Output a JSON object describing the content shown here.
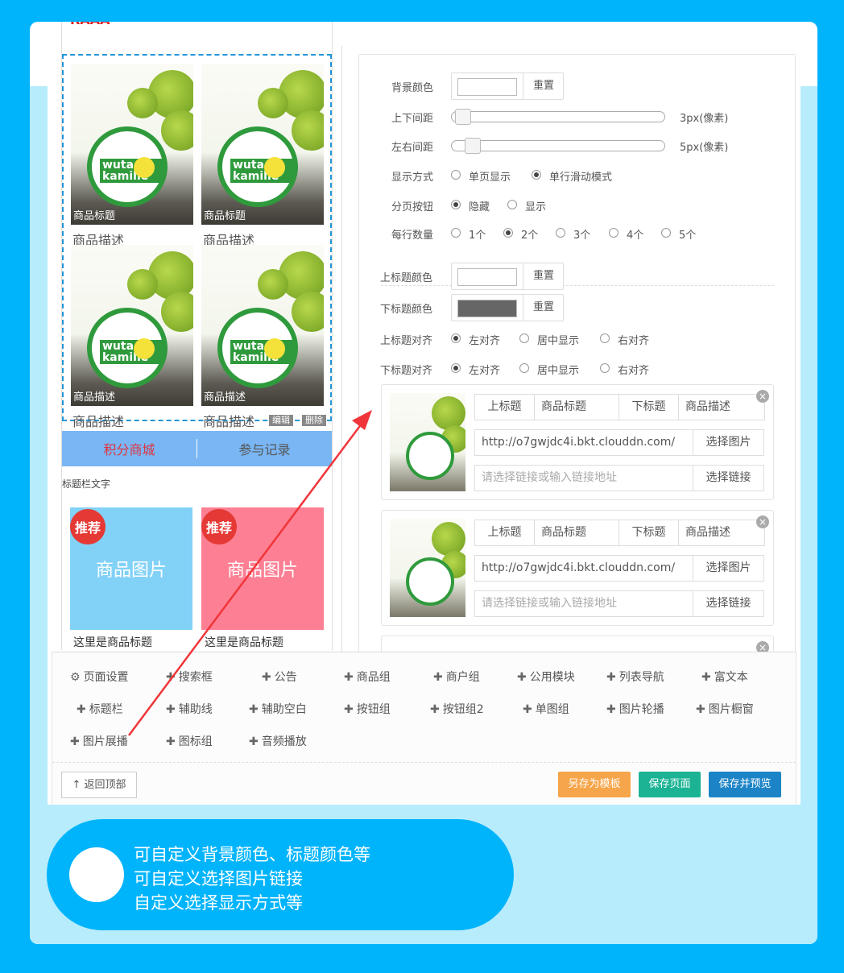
{
  "preview": {
    "products": [
      {
        "title": "商品标题",
        "desc": "商品描述"
      },
      {
        "title": "商品标题",
        "desc": "商品描述"
      },
      {
        "title": "商品描述",
        "desc": "商品描述"
      },
      {
        "title": "商品描述",
        "desc": "商品描述"
      }
    ],
    "edit_label": "编辑",
    "delete_label": "删除",
    "tabs": [
      "积分商城",
      "参与记录"
    ],
    "caption": "标题栏文字",
    "promo": [
      {
        "badge": "推荐",
        "image_text": "商品图片",
        "title": "这里是商品标题",
        "color": "#82d1f7"
      },
      {
        "badge": "推荐",
        "image_text": "商品图片",
        "title": "这里是商品标题",
        "color": "#fd7f93"
      }
    ]
  },
  "settings": {
    "bg_color_label": "背景颜色",
    "reset_label": "重置",
    "vpad_label": "上下间距",
    "vpad_value": "3px(像素)",
    "hpad_label": "左右间距",
    "hpad_value": "5px(像素)",
    "display_label": "显示方式",
    "display_options": [
      "单页显示",
      "单行滑动模式"
    ],
    "display_selected": "单行滑动模式",
    "paging_label": "分页按钮",
    "paging_options": [
      "隐藏",
      "显示"
    ],
    "paging_selected": "隐藏",
    "per_row_label": "每行数量",
    "per_row_options": [
      "1个",
      "2个",
      "3个",
      "4个",
      "5个"
    ],
    "per_row_selected": "2个",
    "top_title_color_label": "上标题颜色",
    "bottom_title_color_label": "下标题颜色",
    "top_title_color": "#ffffff",
    "bottom_title_color": "#666666",
    "top_align_label": "上标题对齐",
    "bottom_align_label": "下标题对齐",
    "align_options": [
      "左对齐",
      "居中显示",
      "右对齐"
    ],
    "align_selected": "左对齐",
    "items": [
      {
        "top_label": "上标题",
        "top_value": "商品标题",
        "bottom_label": "下标题",
        "bottom_value": "商品描述",
        "image_url": "http://o7gwjdc4i.bkt.clouddn.com/",
        "select_image": "选择图片",
        "link_placeholder": "请选择链接或输入链接地址",
        "select_link": "选择链接"
      },
      {
        "top_label": "上标题",
        "top_value": "商品标题",
        "bottom_label": "下标题",
        "bottom_value": "商品描述",
        "image_url": "http://o7gwjdc4i.bkt.clouddn.com/",
        "select_image": "选择图片",
        "link_placeholder": "请选择链接或输入链接地址",
        "select_link": "选择链接"
      }
    ]
  },
  "toolbar": {
    "tools": [
      "页面设置",
      "搜索框",
      "公告",
      "商品组",
      "商户组",
      "公用模块",
      "列表导航",
      "富文本",
      "标题栏",
      "辅助线",
      "辅助空白",
      "按钮组",
      "按钮组2",
      "单图组",
      "图片轮播",
      "图片橱窗",
      "图片展播",
      "图标组",
      "音频播放"
    ],
    "back_top": "返回顶部",
    "save_template": "另存为模板",
    "save_page": "保存页面",
    "save_preview": "保存并预览",
    "colors": {
      "orange": "#f7a54a",
      "green": "#1bb394",
      "blue": "#1c84c6"
    }
  },
  "callout": {
    "lines": [
      "可自定义背景颜色、标题颜色等",
      "可自定义选择图片链接",
      "自定义选择显示方式等"
    ]
  },
  "colors": {
    "frame": "#00b4fc",
    "band": "#b7ecfd",
    "arrow": "#f0353a"
  }
}
